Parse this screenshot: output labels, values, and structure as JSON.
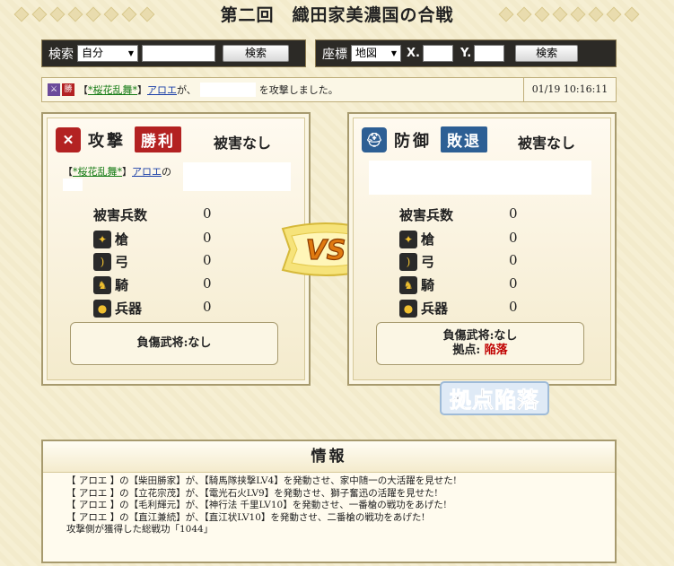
{
  "title": "第二回　織田家美濃国の合戦",
  "search": {
    "label": "検索",
    "select_value": "自分",
    "button": "検索"
  },
  "coords": {
    "label": "座標",
    "select_value": "地図",
    "x_label": "X.",
    "y_label": "Y.",
    "button": "検索"
  },
  "log": {
    "badge": "勝",
    "bracket_open": "【",
    "alliance": "*桜花乱舞*",
    "bracket_close": "】",
    "player": "アロエ",
    "text1": "が、",
    "text2": "を攻撃しました。",
    "time": "01/19 10:16:11"
  },
  "attack": {
    "title": "攻撃",
    "result": "勝利",
    "damage": "被害なし",
    "owner_prefix": "【",
    "alliance": "*桜花乱舞*",
    "owner_mid": "】",
    "player": "アロエ",
    "owner_suffix": "の",
    "losses_label": "被害兵数",
    "losses": "0",
    "units": [
      {
        "name": "槍",
        "value": "0",
        "icon": "spear-icon"
      },
      {
        "name": "弓",
        "value": "0",
        "icon": "bow-icon"
      },
      {
        "name": "騎",
        "value": "0",
        "icon": "horse-icon"
      },
      {
        "name": "兵器",
        "value": "0",
        "icon": "weapon-icon"
      }
    ],
    "injured": "負傷武将:なし"
  },
  "defense": {
    "title": "防御",
    "result": "敗退",
    "damage": "被害なし",
    "losses_label": "被害兵数",
    "losses": "0",
    "units": [
      {
        "name": "槍",
        "value": "0",
        "icon": "spear-icon"
      },
      {
        "name": "弓",
        "value": "0",
        "icon": "bow-icon"
      },
      {
        "name": "騎",
        "value": "0",
        "icon": "horse-icon"
      },
      {
        "name": "兵器",
        "value": "0",
        "icon": "weapon-icon"
      }
    ],
    "injured": "負傷武将:なし",
    "base_label": "拠点:",
    "base_value": "陥落"
  },
  "vs_text": "VS",
  "fallen_text": "拠点陥落",
  "info": {
    "heading": "情報",
    "lines": [
      "【 アロエ 】の【柴田勝家】が、【騎馬隊挟撃LV4】を発動させ、家中随一の大活躍を見せた!",
      "【 アロエ 】の【立花宗茂】が、【電光石火LV9】を発動させ、獅子奮迅の活躍を見せた!",
      "【 アロエ 】の【毛利輝元】が、【神行法 千里LV10】を発動させ、一番槍の戦功をあげた!",
      "【 アロエ 】の【直江兼続】が、【直江状LV10】を発動させ、二番槍の戦功をあげた!",
      "攻撃側が獲得した総戦功「1044」"
    ]
  },
  "colors": {
    "win": "#b32222",
    "lose": "#2d5f94",
    "fallen": "#c00000",
    "alliance_link": "#137a13"
  }
}
